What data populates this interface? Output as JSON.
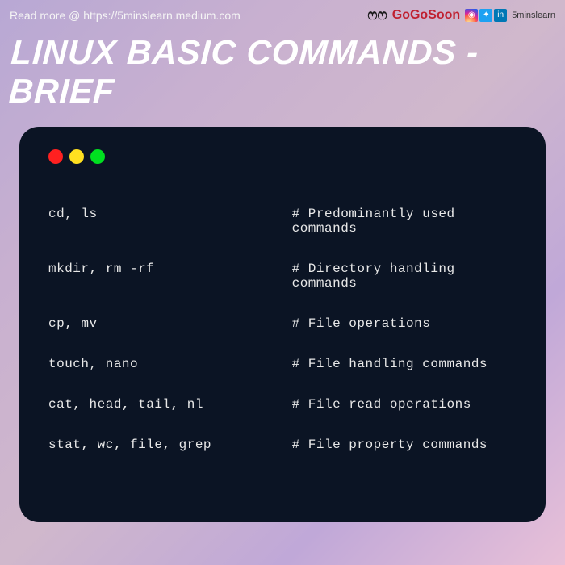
{
  "header": {
    "read_more": "Read more @ https://5minslearn.medium.com",
    "brand": "GoGoSoon",
    "handle": "5minslearn"
  },
  "title": "LINUX BASIC COMMANDS - BRIEF",
  "commands": [
    {
      "cmd": "cd, ls",
      "desc": "# Predominantly used commands"
    },
    {
      "cmd": "mkdir, rm -rf",
      "desc": "# Directory handling commands"
    },
    {
      "cmd": "cp, mv",
      "desc": "# File operations"
    },
    {
      "cmd": "touch, nano",
      "desc": "# File handling commands"
    },
    {
      "cmd": "cat, head, tail, nl",
      "desc": "# File read operations"
    },
    {
      "cmd": "stat, wc, file, grep",
      "desc": "# File property commands"
    }
  ]
}
